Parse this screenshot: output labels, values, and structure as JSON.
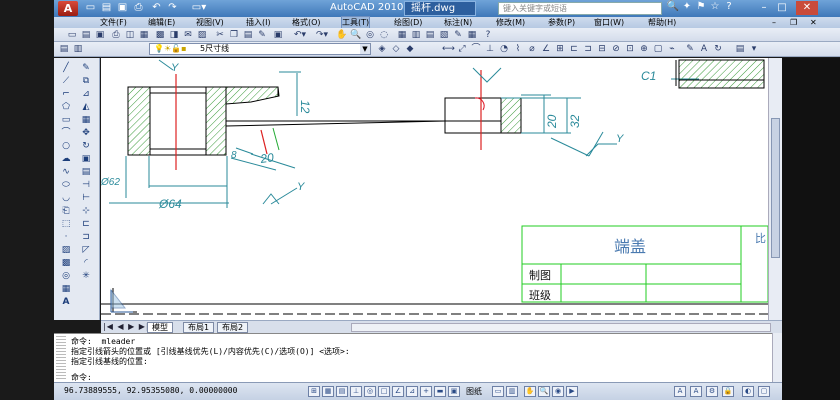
{
  "titlebar": {
    "app_title": "AutoCAD 2010",
    "file_tab": "摇杆.dwg",
    "search_placeholder": "键入关键字或短语",
    "min": "–",
    "max": "□",
    "close": "✕"
  },
  "menubar": {
    "items": [
      "文件(F)",
      "编辑(E)",
      "视图(V)",
      "插入(I)",
      "格式(O)",
      "工具(T)",
      "绘图(D)",
      "标注(N)",
      "修改(M)",
      "参数(P)",
      "窗口(W)",
      "帮助(H)"
    ]
  },
  "layer": {
    "current": "5尺寸线"
  },
  "drawing": {
    "dims": {
      "d1": "12",
      "d2": "20",
      "d3": "32",
      "d4": "20",
      "d5": "8",
      "d6": "Ø62",
      "d7": "Ø64",
      "c1": "C1",
      "y": "Y"
    },
    "titleblock": {
      "title": "端盖",
      "row1": "制图",
      "row2": "班级",
      "right": "比"
    }
  },
  "tabs": {
    "model": "模型",
    "layout1": "布局1",
    "layout2": "布局2"
  },
  "command": {
    "line1": "命令:  mleader",
    "line2": "指定引线箭头的位置或 [引线基线优先(L)/内容优先(C)/选项(O)] <选项>:",
    "line3": "指定引线基线的位置:",
    "line4": "命令:"
  },
  "status": {
    "coords": "96.73889555,  92.95355080,  0.00000000",
    "model_label": "图纸"
  }
}
